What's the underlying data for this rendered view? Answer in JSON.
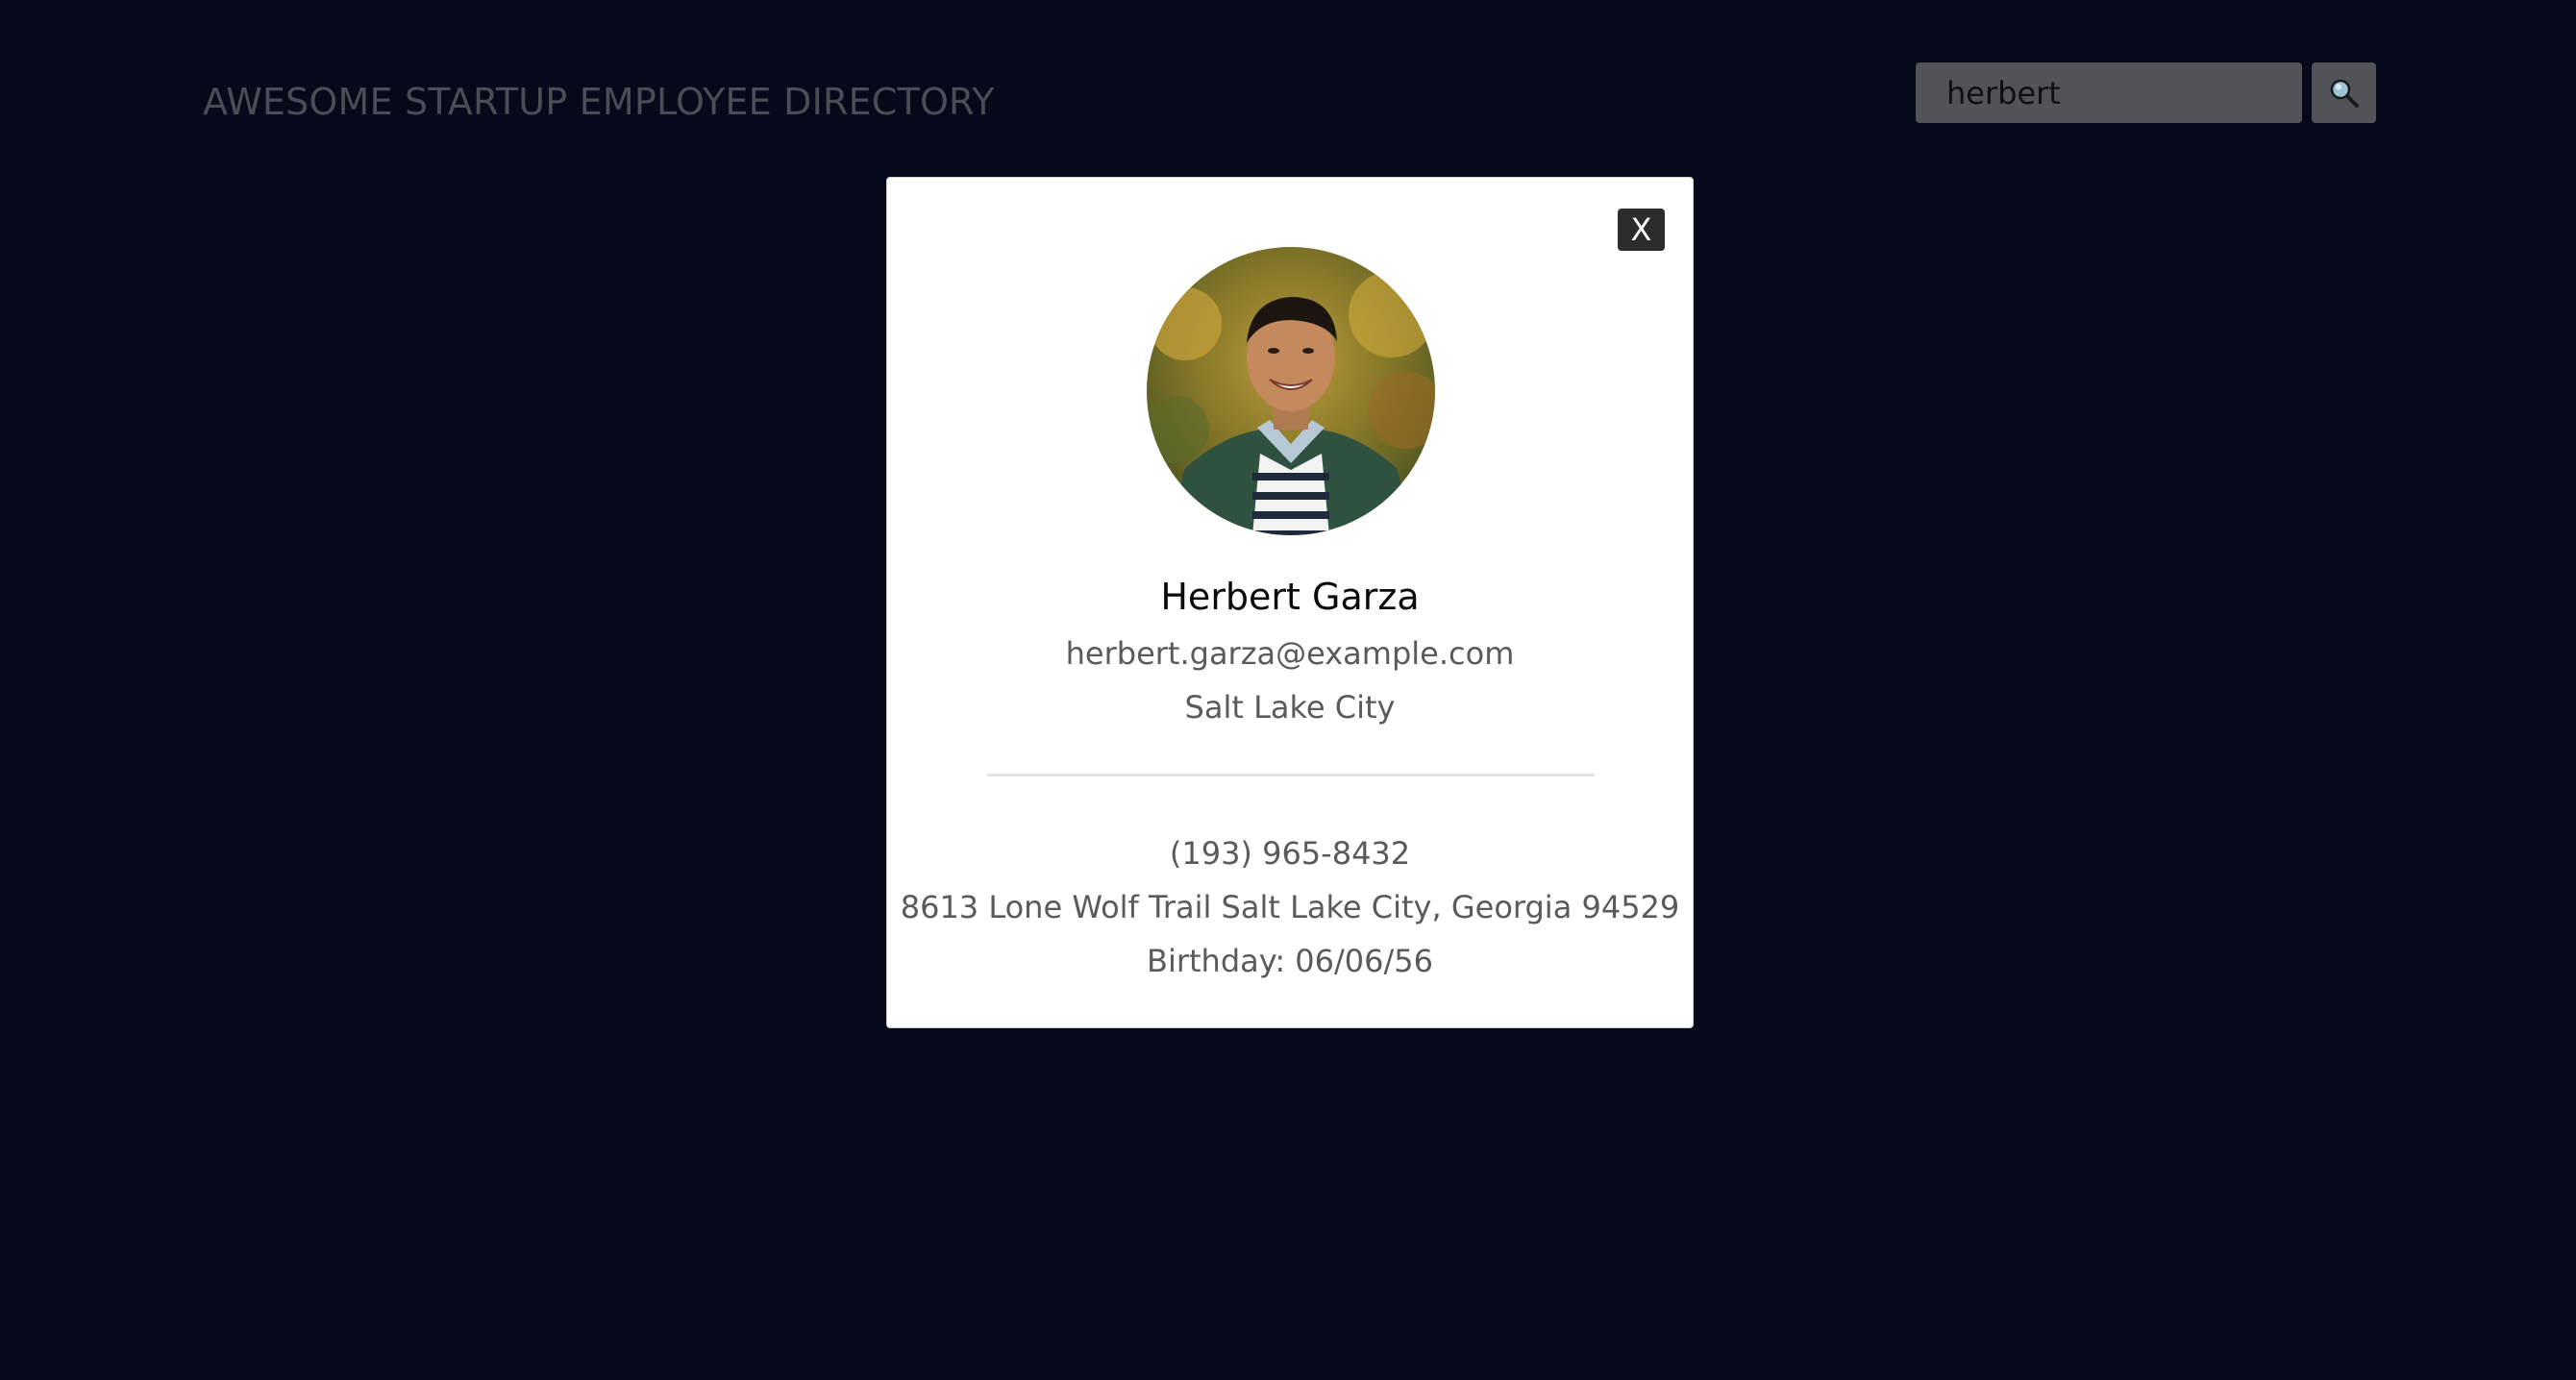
{
  "header": {
    "title": "AWESOME STARTUP EMPLOYEE DIRECTORY"
  },
  "search": {
    "value": "herbert",
    "button_icon": "magnifier-icon"
  },
  "modal": {
    "close_label": "X",
    "avatar_icon": "employee-photo",
    "name": "Herbert Garza",
    "email": "herbert.garza@example.com",
    "city": "Salt Lake City",
    "phone": "(193) 965-8432",
    "address": "8613 Lone Wolf Trail Salt Lake City, Georgia 94529",
    "birthday": "Birthday: 06/06/56"
  },
  "colors": {
    "background": "#05091a",
    "modal_background": "#ffffff",
    "close_button": "#2c2c2c",
    "search_field": "#515358"
  }
}
